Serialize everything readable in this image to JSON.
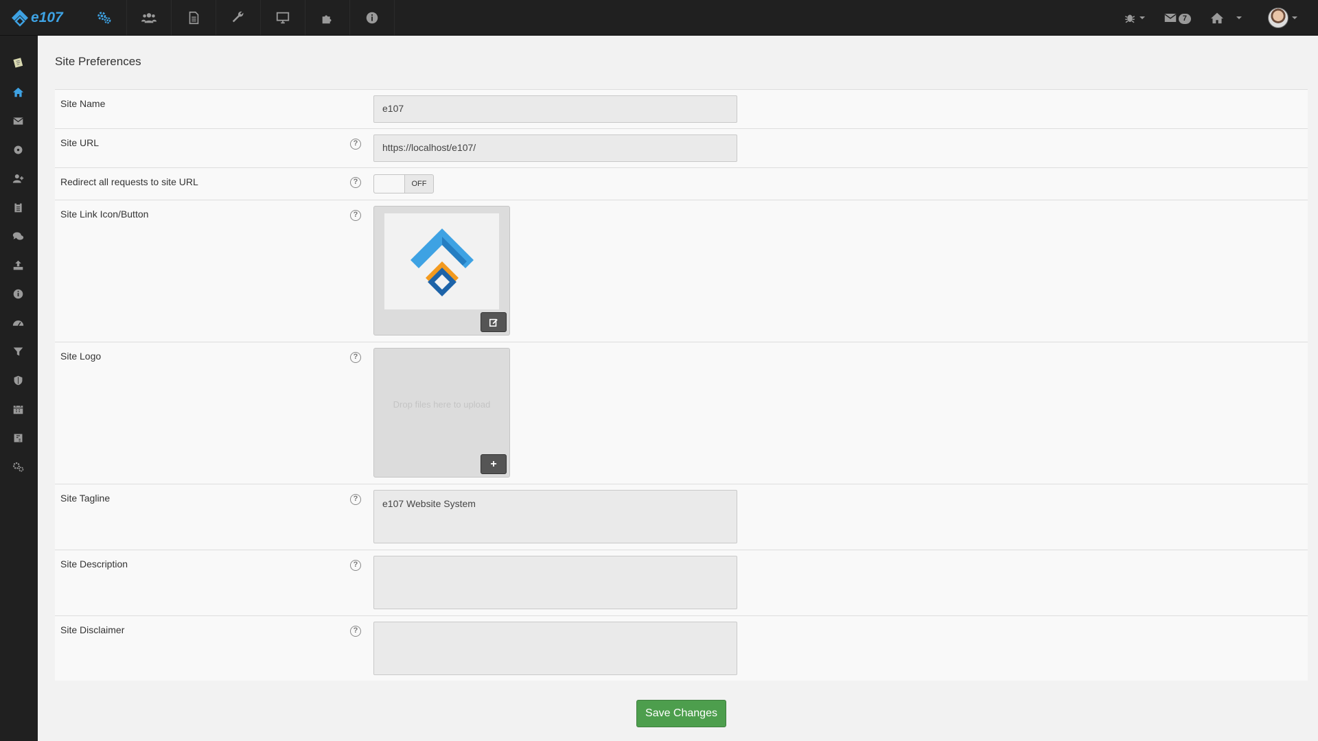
{
  "brand": {
    "name": "e107"
  },
  "topnav": [
    {
      "icon": "settings-cogs-icon",
      "active": true
    },
    {
      "icon": "users-icon"
    },
    {
      "icon": "content-page-icon"
    },
    {
      "icon": "tools-wrench-icon"
    },
    {
      "icon": "appearance-monitor-icon"
    },
    {
      "icon": "plugins-puzzle-icon"
    },
    {
      "icon": "about-info-icon"
    }
  ],
  "topright": {
    "debug_icon": "bug-icon",
    "messages_icon": "envelope-icon",
    "messages_count": "7",
    "home_icon": "home-icon",
    "avatar": "user-avatar"
  },
  "sidebar": [
    "notepad-icon",
    "home-icon",
    "envelope-icon",
    "disc-icon",
    "user-add-icon",
    "clipboard-icon",
    "comments-icon",
    "upload-icon",
    "info-icon",
    "dashboard-icon",
    "filter-icon",
    "shield-icon",
    "calendar-icon",
    "js-file-icon",
    "cogs-icon"
  ],
  "page": {
    "title": "Site Preferences",
    "rows": {
      "site_name": {
        "label": "Site Name",
        "value": "e107"
      },
      "site_url": {
        "label": "Site URL",
        "value": "https://localhost/e107/"
      },
      "redirect": {
        "label": "Redirect all requests to site URL",
        "state": "OFF"
      },
      "link_button": {
        "label": "Site Link Icon/Button"
      },
      "logo": {
        "label": "Site Logo",
        "drop_text": "Drop files here to upload"
      },
      "tagline": {
        "label": "Site Tagline",
        "value": "e107 Website System"
      },
      "description": {
        "label": "Site Description",
        "value": ""
      },
      "disclaimer": {
        "label": "Site Disclaimer",
        "value": ""
      }
    },
    "help_symbol": "?",
    "save_label": "Save Changes"
  },
  "colors": {
    "accent": "#3ea2e3",
    "logo_orange": "#f39a1f",
    "save_green": "#4d9e4d",
    "dark_bar": "#202020"
  }
}
